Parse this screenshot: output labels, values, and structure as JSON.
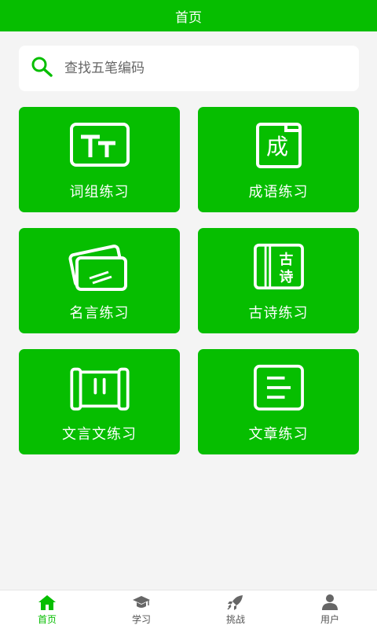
{
  "header": {
    "title": "首页"
  },
  "search": {
    "placeholder": "查找五笔编码"
  },
  "cards": [
    {
      "label": "词组练习",
      "icon": "tt-text-icon"
    },
    {
      "label": "成语练习",
      "icon": "cheng-book-icon"
    },
    {
      "label": "名言练习",
      "icon": "cards-icon"
    },
    {
      "label": "古诗练习",
      "icon": "gushi-book-icon"
    },
    {
      "label": "文言文练习",
      "icon": "scroll-icon"
    },
    {
      "label": "文章练习",
      "icon": "document-icon"
    }
  ],
  "icon_glyphs": {
    "cheng": "成",
    "gu": "古",
    "shi": "诗"
  },
  "tabs": [
    {
      "label": "首页",
      "icon": "home-icon",
      "active": true
    },
    {
      "label": "学习",
      "icon": "graduation-cap-icon",
      "active": false
    },
    {
      "label": "挑战",
      "icon": "rocket-icon",
      "active": false
    },
    {
      "label": "用户",
      "icon": "user-icon",
      "active": false
    }
  ],
  "colors": {
    "brand": "#06be00",
    "background": "#f4f4f4"
  }
}
